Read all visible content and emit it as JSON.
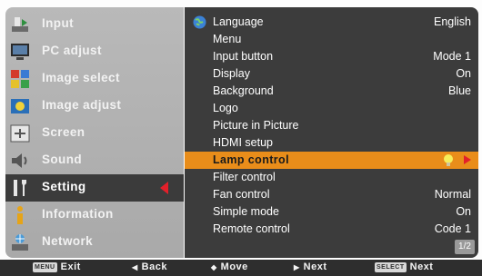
{
  "left_menu": [
    {
      "label": "Input",
      "icon": "input-icon",
      "active": false
    },
    {
      "label": "PC adjust",
      "icon": "pc-adjust-icon",
      "active": false
    },
    {
      "label": "Image select",
      "icon": "image-select-icon",
      "active": false
    },
    {
      "label": "Image adjust",
      "icon": "image-adjust-icon",
      "active": false
    },
    {
      "label": "Screen",
      "icon": "screen-icon",
      "active": false
    },
    {
      "label": "Sound",
      "icon": "sound-icon",
      "active": false
    },
    {
      "label": "Setting",
      "icon": "setting-icon",
      "active": true
    },
    {
      "label": "Information",
      "icon": "information-icon",
      "active": false
    },
    {
      "label": "Network",
      "icon": "network-icon",
      "active": false
    }
  ],
  "settings": [
    {
      "name": "Language",
      "value": "English"
    },
    {
      "name": "Menu",
      "value": ""
    },
    {
      "name": "Input button",
      "value": "Mode 1"
    },
    {
      "name": "Display",
      "value": "On"
    },
    {
      "name": "Background",
      "value": "Blue"
    },
    {
      "name": "Logo",
      "value": ""
    },
    {
      "name": "Picture in Picture",
      "value": ""
    },
    {
      "name": "HDMI setup",
      "value": ""
    },
    {
      "name": "Lamp control",
      "value": "",
      "highlighted": true
    },
    {
      "name": "Filter control",
      "value": ""
    },
    {
      "name": "Fan control",
      "value": "Normal"
    },
    {
      "name": "Simple mode",
      "value": "On"
    },
    {
      "name": "Remote control",
      "value": "Code 1"
    }
  ],
  "page_indicator": "1/2",
  "bottom_bar": {
    "exit": {
      "key": "MENU",
      "label": "Exit"
    },
    "back": {
      "label": "Back"
    },
    "move": {
      "label": "Move"
    },
    "next": {
      "label": "Next"
    },
    "select": {
      "key": "SELECT",
      "label": "Next"
    }
  },
  "colors": {
    "highlight": "#e98d1a",
    "active_arrow": "#e3202a",
    "panel_dark": "#3c3c3c",
    "panel_light": "#b3b3b3"
  }
}
